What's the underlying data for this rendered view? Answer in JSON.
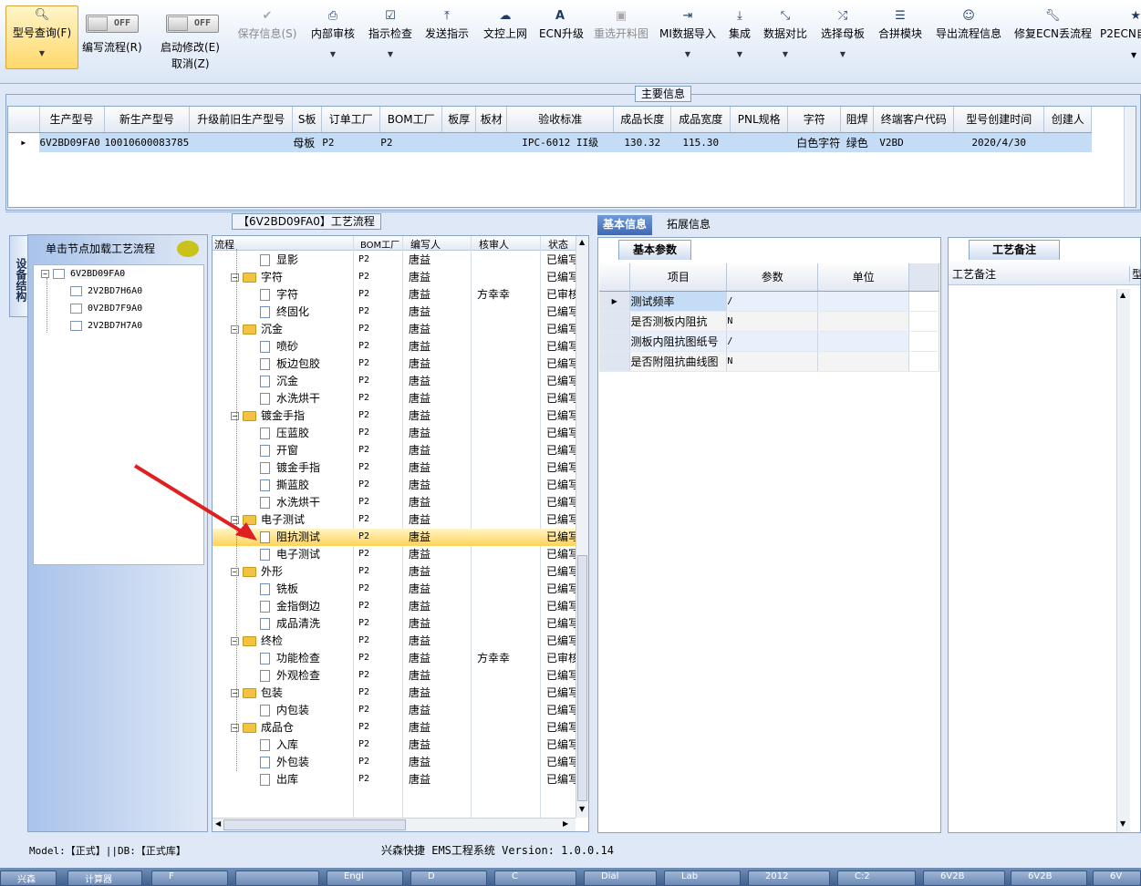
{
  "toolbar": {
    "query": "型号查询(F)",
    "write_flow": "编写流程(R)",
    "write_toggle": "OFF",
    "start_modify": "启动修改(E)",
    "cancel": "取消(Z)",
    "modify_toggle": "OFF",
    "save": "保存信息(S)",
    "internal_review": "内部审核",
    "instruction_check": "指示检查",
    "send_instruction": "发送指示",
    "doc_upload": "文控上网",
    "ecn_upgrade": "ECN升级",
    "reselect": "重选开料图",
    "mi_import": "MI数据导入",
    "integrate": "集成",
    "data_compare": "数据对比",
    "select_board": "选择母板",
    "merge_module": "合拼模块",
    "export_flow": "导出流程信息",
    "repair_ecn": "修复ECN丢流程",
    "p2ecn": "P2ECN自"
  },
  "main_info": {
    "title": "主要信息",
    "columns": [
      "生产型号",
      "新生产型号",
      "升级前旧生产型号",
      "S板",
      "订单工厂",
      "BOM工厂",
      "板厚",
      "板材",
      "验收标准",
      "成品长度",
      "成品宽度",
      "PNL规格",
      "字符",
      "阻焊",
      "终端客户代码",
      "型号创建时间",
      "创建人"
    ],
    "row": {
      "model": "6V2BD09FA0",
      "new_model": "10010600083785",
      "old_model": "",
      "s_board": "母板",
      "order_factory": "P2",
      "bom_factory": "P2",
      "thickness": "",
      "material": "",
      "standard": "IPC-6012 II级",
      "length": "130.32",
      "width": "115.30",
      "pnl": "",
      "char": "白色字符",
      "solder": "绿色",
      "customer": "V2BD",
      "created": "2020/4/30",
      "creator": ""
    }
  },
  "side": {
    "tab": "设备结构",
    "header": "单击节点加载工艺流程",
    "root": "6V2BD09FA0",
    "children": [
      "2V2BD7H6A0",
      "0V2BD7F9A0",
      "2V2BD7H7A0"
    ]
  },
  "process": {
    "title": "【6V2BD09FA0】工艺流程",
    "headers": {
      "flow": "流程",
      "bom": "BOM工厂",
      "writer": "编写人",
      "reviewer": "核审人",
      "status": "状态"
    },
    "rows": [
      {
        "level": 1,
        "name": "显影",
        "bom": "P2",
        "writer": "唐益",
        "reviewer": "",
        "status": "已编写"
      },
      {
        "level": 0,
        "name": "字符",
        "bom": "P2",
        "writer": "唐益",
        "reviewer": "",
        "status": "已编写"
      },
      {
        "level": 1,
        "name": "字符",
        "bom": "P2",
        "writer": "唐益",
        "reviewer": "方幸幸",
        "status": "已审核"
      },
      {
        "level": 1,
        "name": "终固化",
        "bom": "P2",
        "writer": "唐益",
        "reviewer": "",
        "status": "已编写"
      },
      {
        "level": 0,
        "name": "沉金",
        "bom": "P2",
        "writer": "唐益",
        "reviewer": "",
        "status": "已编写"
      },
      {
        "level": 1,
        "name": "喷砂",
        "bom": "P2",
        "writer": "唐益",
        "reviewer": "",
        "status": "已编写"
      },
      {
        "level": 1,
        "name": "板边包胶",
        "bom": "P2",
        "writer": "唐益",
        "reviewer": "",
        "status": "已编写"
      },
      {
        "level": 1,
        "name": "沉金",
        "bom": "P2",
        "writer": "唐益",
        "reviewer": "",
        "status": "已编写"
      },
      {
        "level": 1,
        "name": "水洗烘干",
        "bom": "P2",
        "writer": "唐益",
        "reviewer": "",
        "status": "已编写"
      },
      {
        "level": 0,
        "name": "镀金手指",
        "bom": "P2",
        "writer": "唐益",
        "reviewer": "",
        "status": "已编写"
      },
      {
        "level": 1,
        "name": "压蓝胶",
        "bom": "P2",
        "writer": "唐益",
        "reviewer": "",
        "status": "已编写"
      },
      {
        "level": 1,
        "name": "开窗",
        "bom": "P2",
        "writer": "唐益",
        "reviewer": "",
        "status": "已编写"
      },
      {
        "level": 1,
        "name": "镀金手指",
        "bom": "P2",
        "writer": "唐益",
        "reviewer": "",
        "status": "已编写"
      },
      {
        "level": 1,
        "name": "撕蓝胶",
        "bom": "P2",
        "writer": "唐益",
        "reviewer": "",
        "status": "已编写"
      },
      {
        "level": 1,
        "name": "水洗烘干",
        "bom": "P2",
        "writer": "唐益",
        "reviewer": "",
        "status": "已编写"
      },
      {
        "level": 0,
        "name": "电子测试",
        "bom": "P2",
        "writer": "唐益",
        "reviewer": "",
        "status": "已编写"
      },
      {
        "level": 1,
        "name": "阻抗测试",
        "bom": "P2",
        "writer": "唐益",
        "reviewer": "",
        "status": "已编写",
        "selected": true
      },
      {
        "level": 1,
        "name": "电子测试",
        "bom": "P2",
        "writer": "唐益",
        "reviewer": "",
        "status": "已编写"
      },
      {
        "level": 0,
        "name": "外形",
        "bom": "P2",
        "writer": "唐益",
        "reviewer": "",
        "status": "已编写"
      },
      {
        "level": 1,
        "name": "铣板",
        "bom": "P2",
        "writer": "唐益",
        "reviewer": "",
        "status": "已编写"
      },
      {
        "level": 1,
        "name": "金指倒边",
        "bom": "P2",
        "writer": "唐益",
        "reviewer": "",
        "status": "已编写"
      },
      {
        "level": 1,
        "name": "成品清洗",
        "bom": "P2",
        "writer": "唐益",
        "reviewer": "",
        "status": "已编写"
      },
      {
        "level": 0,
        "name": "终检",
        "bom": "P2",
        "writer": "唐益",
        "reviewer": "",
        "status": "已编写"
      },
      {
        "level": 1,
        "name": "功能检查",
        "bom": "P2",
        "writer": "唐益",
        "reviewer": "方幸幸",
        "status": "已审核"
      },
      {
        "level": 1,
        "name": "外观检查",
        "bom": "P2",
        "writer": "唐益",
        "reviewer": "",
        "status": "已编写"
      },
      {
        "level": 0,
        "name": "包装",
        "bom": "P2",
        "writer": "唐益",
        "reviewer": "",
        "status": "已编写"
      },
      {
        "level": 1,
        "name": "内包装",
        "bom": "P2",
        "writer": "唐益",
        "reviewer": "",
        "status": "已编写"
      },
      {
        "level": 0,
        "name": "成品仓",
        "bom": "P2",
        "writer": "唐益",
        "reviewer": "",
        "status": "已编写"
      },
      {
        "level": 1,
        "name": "入库",
        "bom": "P2",
        "writer": "唐益",
        "reviewer": "",
        "status": "已编写"
      },
      {
        "level": 1,
        "name": "外包装",
        "bom": "P2",
        "writer": "唐益",
        "reviewer": "",
        "status": "已编写"
      },
      {
        "level": 1,
        "name": "出库",
        "bom": "P2",
        "writer": "唐益",
        "reviewer": "",
        "status": "已编写"
      }
    ]
  },
  "right": {
    "tab_basic": "基本信息",
    "tab_ext": "拓展信息",
    "basic_title": "基本参数",
    "param_headers": {
      "item": "项目",
      "param": "参数",
      "unit": "单位"
    },
    "params": [
      {
        "item": "测试频率",
        "param": "/",
        "unit": ""
      },
      {
        "item": "是否测板内阻抗",
        "param": "N",
        "unit": ""
      },
      {
        "item": "测板内阻抗图纸号",
        "param": "/",
        "unit": ""
      },
      {
        "item": "是否附阻抗曲线图",
        "param": "N",
        "unit": ""
      }
    ],
    "remark_title": "工艺备注",
    "remark_col": "工艺备注",
    "remark_col2": "型"
  },
  "status": {
    "left": "Model:【正式】||DB:【正式库】",
    "center": "兴森快捷 EMS工程系统 Version: 1.0.0.14"
  },
  "taskbar": [
    "兴森",
    "计算器",
    "F",
    "",
    "Engi",
    "D",
    "C",
    "Dial",
    "Lab",
    "2012",
    "C:2",
    "6V2B",
    "6V2B",
    "6V"
  ],
  "colors": {
    "accent": "#3d69b4",
    "selection": "#ffd35a",
    "grid_select": "#c4dcf5",
    "arrow": "#e02020"
  }
}
